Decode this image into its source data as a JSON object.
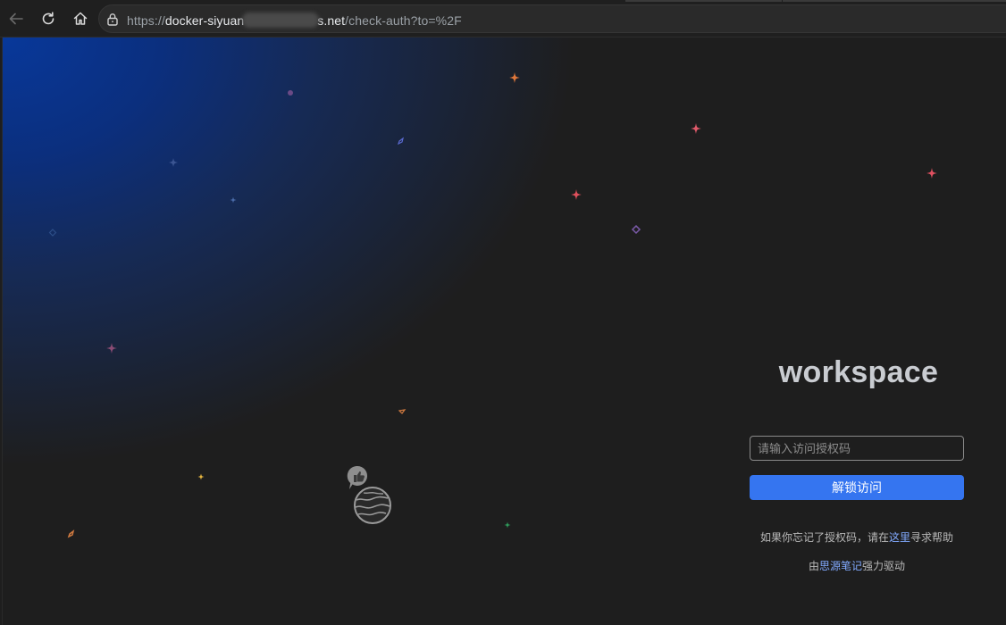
{
  "browser": {
    "url_prefix": "https://",
    "url_host_start": "docker-siyuan",
    "url_host_end": "s.net",
    "url_path": "/check-auth?to=%2F"
  },
  "icons": {
    "back": "back-arrow-icon",
    "reload": "reload-icon",
    "home": "home-icon",
    "lock": "lock-icon",
    "mascot": "siyuan-planet-logo-icon",
    "like": "thumbs-up-icon"
  },
  "login": {
    "brand": "workspace",
    "password_placeholder": "请输入访问授权码",
    "unlock_label": "解锁访问",
    "forgot_prefix": "如果你忘记了授权码，请在",
    "forgot_link": "这里",
    "forgot_suffix": "寻求帮助",
    "powered_prefix": "由",
    "powered_link": "思源笔记",
    "powered_suffix": "强力驱动"
  },
  "colors": {
    "accent": "#3575f0",
    "link": "#82aaff",
    "page_bg": "#1e1e1e",
    "glow": "#08389a"
  }
}
